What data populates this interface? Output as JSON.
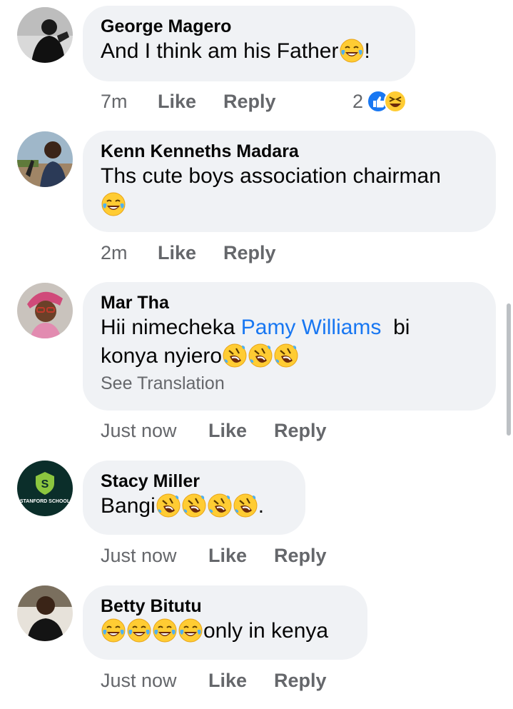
{
  "comments": [
    {
      "name": "George Magero",
      "text_parts": [
        "And I think am his Father",
        "!"
      ],
      "time": "7m",
      "like": "Like",
      "reply": "Reply",
      "reaction_count": "2",
      "reaction_icons": [
        "like-icon",
        "laugh-icon"
      ]
    },
    {
      "name": "Kenn Kenneths Madara",
      "text_line1": "Ths cute boys association chairman",
      "time": "2m",
      "like": "Like",
      "reply": "Reply"
    },
    {
      "name": "Mar Tha",
      "text_before_mention": "Hii nimecheka ",
      "mention": "Pamy Williams",
      "text_after_mention": "  bi",
      "text_line2": "konya nyiero",
      "see_translation": "See Translation",
      "time": "Just now",
      "like": "Like",
      "reply": "Reply"
    },
    {
      "name": "Stacy Miller",
      "text_before": "Bangi",
      "text_after": ".",
      "avatar_text": "STANFORD SCHOOL",
      "avatar_letter": "S",
      "time": "Just now",
      "like": "Like",
      "reply": "Reply"
    },
    {
      "name": "Betty Bitutu",
      "text_after": "only in kenya",
      "time": "Just now",
      "like": "Like",
      "reply": "Reply"
    }
  ],
  "colors": {
    "bubble": "#f0f2f5",
    "secondary_text": "#65676b",
    "mention": "#1877f2",
    "like_blue": "#1877f2",
    "emoji_yellow": "#ffcc33"
  }
}
